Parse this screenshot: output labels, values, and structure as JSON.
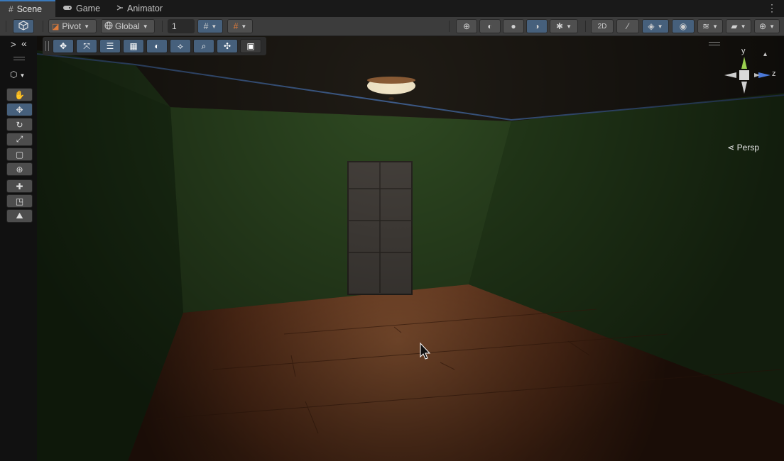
{
  "tabs": [
    {
      "label": "Scene",
      "icon": "grid-icon",
      "active": true
    },
    {
      "label": "Game",
      "icon": "gamepad-icon",
      "active": false
    },
    {
      "label": "Animator",
      "icon": "animator-icon",
      "active": false
    }
  ],
  "toolbar": {
    "pivot_label": "Pivot",
    "global_label": "Global",
    "grid_snap_value": "1"
  },
  "viewport": {
    "projection_label": "Persp",
    "gizmo_axes": {
      "y": "y",
      "z": "z"
    }
  },
  "overlay_toggle": {
    "expand": ">",
    "collapse": "«"
  },
  "colors": {
    "accent": "#3a79bb",
    "active_button": "#46607c",
    "panel": "#3c3c3c",
    "wall": "#2f4a22",
    "floor": "#7a4124"
  }
}
